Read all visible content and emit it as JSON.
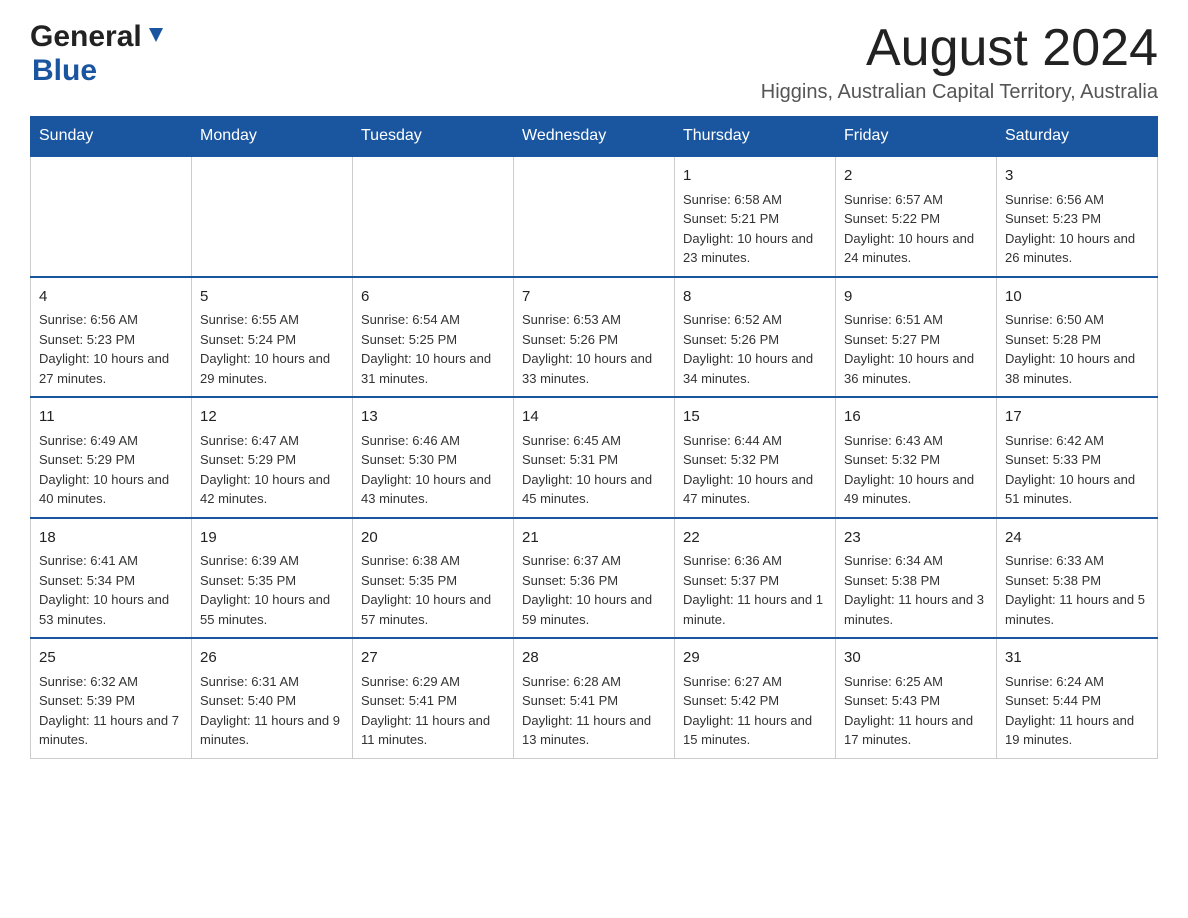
{
  "logo": {
    "general": "General",
    "blue": "Blue"
  },
  "title": "August 2024",
  "subtitle": "Higgins, Australian Capital Territory, Australia",
  "weekdays": [
    "Sunday",
    "Monday",
    "Tuesday",
    "Wednesday",
    "Thursday",
    "Friday",
    "Saturday"
  ],
  "weeks": [
    [
      {
        "num": "",
        "info": ""
      },
      {
        "num": "",
        "info": ""
      },
      {
        "num": "",
        "info": ""
      },
      {
        "num": "",
        "info": ""
      },
      {
        "num": "1",
        "info": "Sunrise: 6:58 AM\nSunset: 5:21 PM\nDaylight: 10 hours and 23 minutes."
      },
      {
        "num": "2",
        "info": "Sunrise: 6:57 AM\nSunset: 5:22 PM\nDaylight: 10 hours and 24 minutes."
      },
      {
        "num": "3",
        "info": "Sunrise: 6:56 AM\nSunset: 5:23 PM\nDaylight: 10 hours and 26 minutes."
      }
    ],
    [
      {
        "num": "4",
        "info": "Sunrise: 6:56 AM\nSunset: 5:23 PM\nDaylight: 10 hours and 27 minutes."
      },
      {
        "num": "5",
        "info": "Sunrise: 6:55 AM\nSunset: 5:24 PM\nDaylight: 10 hours and 29 minutes."
      },
      {
        "num": "6",
        "info": "Sunrise: 6:54 AM\nSunset: 5:25 PM\nDaylight: 10 hours and 31 minutes."
      },
      {
        "num": "7",
        "info": "Sunrise: 6:53 AM\nSunset: 5:26 PM\nDaylight: 10 hours and 33 minutes."
      },
      {
        "num": "8",
        "info": "Sunrise: 6:52 AM\nSunset: 5:26 PM\nDaylight: 10 hours and 34 minutes."
      },
      {
        "num": "9",
        "info": "Sunrise: 6:51 AM\nSunset: 5:27 PM\nDaylight: 10 hours and 36 minutes."
      },
      {
        "num": "10",
        "info": "Sunrise: 6:50 AM\nSunset: 5:28 PM\nDaylight: 10 hours and 38 minutes."
      }
    ],
    [
      {
        "num": "11",
        "info": "Sunrise: 6:49 AM\nSunset: 5:29 PM\nDaylight: 10 hours and 40 minutes."
      },
      {
        "num": "12",
        "info": "Sunrise: 6:47 AM\nSunset: 5:29 PM\nDaylight: 10 hours and 42 minutes."
      },
      {
        "num": "13",
        "info": "Sunrise: 6:46 AM\nSunset: 5:30 PM\nDaylight: 10 hours and 43 minutes."
      },
      {
        "num": "14",
        "info": "Sunrise: 6:45 AM\nSunset: 5:31 PM\nDaylight: 10 hours and 45 minutes."
      },
      {
        "num": "15",
        "info": "Sunrise: 6:44 AM\nSunset: 5:32 PM\nDaylight: 10 hours and 47 minutes."
      },
      {
        "num": "16",
        "info": "Sunrise: 6:43 AM\nSunset: 5:32 PM\nDaylight: 10 hours and 49 minutes."
      },
      {
        "num": "17",
        "info": "Sunrise: 6:42 AM\nSunset: 5:33 PM\nDaylight: 10 hours and 51 minutes."
      }
    ],
    [
      {
        "num": "18",
        "info": "Sunrise: 6:41 AM\nSunset: 5:34 PM\nDaylight: 10 hours and 53 minutes."
      },
      {
        "num": "19",
        "info": "Sunrise: 6:39 AM\nSunset: 5:35 PM\nDaylight: 10 hours and 55 minutes."
      },
      {
        "num": "20",
        "info": "Sunrise: 6:38 AM\nSunset: 5:35 PM\nDaylight: 10 hours and 57 minutes."
      },
      {
        "num": "21",
        "info": "Sunrise: 6:37 AM\nSunset: 5:36 PM\nDaylight: 10 hours and 59 minutes."
      },
      {
        "num": "22",
        "info": "Sunrise: 6:36 AM\nSunset: 5:37 PM\nDaylight: 11 hours and 1 minute."
      },
      {
        "num": "23",
        "info": "Sunrise: 6:34 AM\nSunset: 5:38 PM\nDaylight: 11 hours and 3 minutes."
      },
      {
        "num": "24",
        "info": "Sunrise: 6:33 AM\nSunset: 5:38 PM\nDaylight: 11 hours and 5 minutes."
      }
    ],
    [
      {
        "num": "25",
        "info": "Sunrise: 6:32 AM\nSunset: 5:39 PM\nDaylight: 11 hours and 7 minutes."
      },
      {
        "num": "26",
        "info": "Sunrise: 6:31 AM\nSunset: 5:40 PM\nDaylight: 11 hours and 9 minutes."
      },
      {
        "num": "27",
        "info": "Sunrise: 6:29 AM\nSunset: 5:41 PM\nDaylight: 11 hours and 11 minutes."
      },
      {
        "num": "28",
        "info": "Sunrise: 6:28 AM\nSunset: 5:41 PM\nDaylight: 11 hours and 13 minutes."
      },
      {
        "num": "29",
        "info": "Sunrise: 6:27 AM\nSunset: 5:42 PM\nDaylight: 11 hours and 15 minutes."
      },
      {
        "num": "30",
        "info": "Sunrise: 6:25 AM\nSunset: 5:43 PM\nDaylight: 11 hours and 17 minutes."
      },
      {
        "num": "31",
        "info": "Sunrise: 6:24 AM\nSunset: 5:44 PM\nDaylight: 11 hours and 19 minutes."
      }
    ]
  ]
}
